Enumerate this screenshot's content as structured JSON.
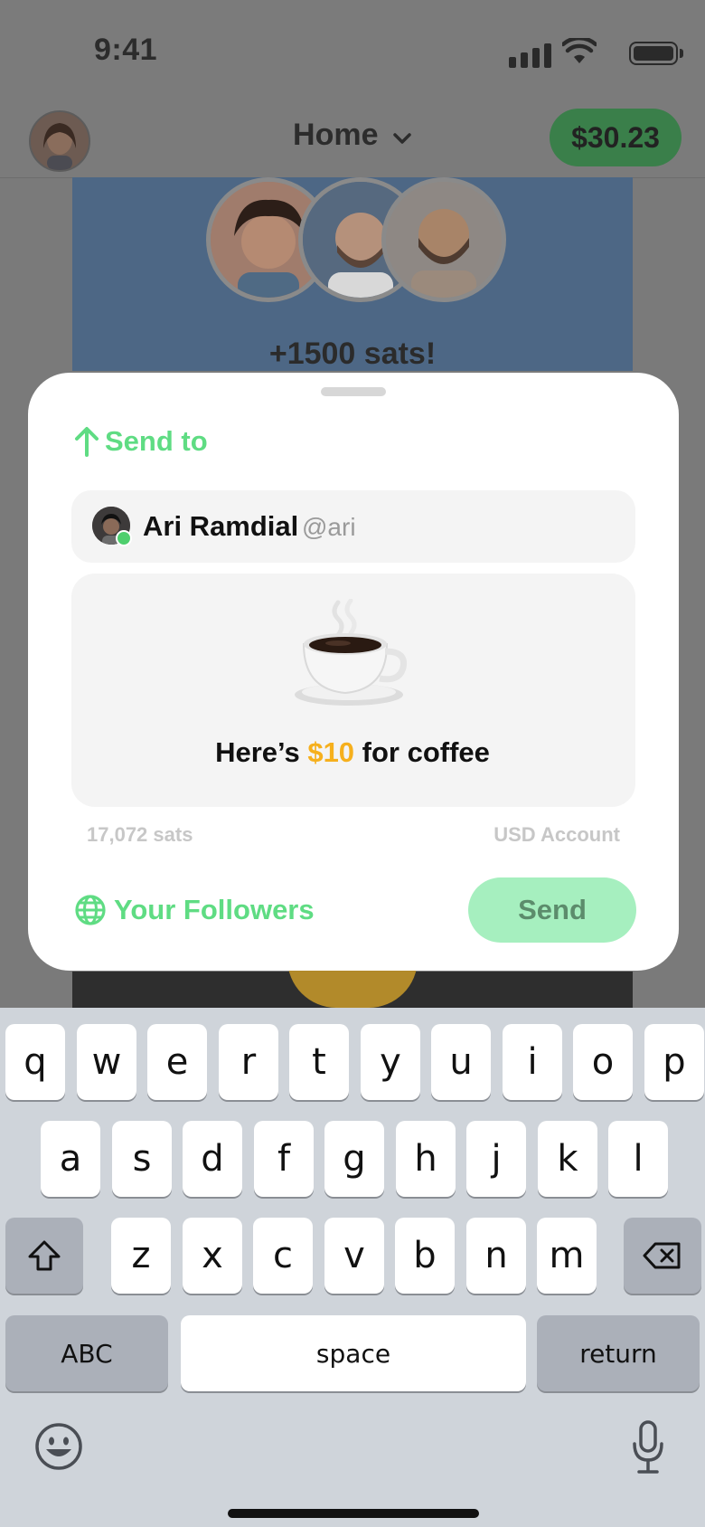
{
  "status_bar": {
    "time": "9:41"
  },
  "header": {
    "title": "Home",
    "balance": "$30.23"
  },
  "background_card": {
    "headline": "+1500 sats!"
  },
  "sheet": {
    "send_to_label": "Send to",
    "recipient": {
      "name": "Ari Ramdial",
      "handle": "@ari"
    },
    "message": {
      "prefix": "Here’s ",
      "amount": "$10",
      "suffix": " for coffee"
    },
    "sats_value": "17,072 sats",
    "account_label": "USD Account",
    "audience_label": "Your Followers",
    "send_label": "Send"
  },
  "keyboard": {
    "row1": [
      "q",
      "w",
      "e",
      "r",
      "t",
      "y",
      "u",
      "i",
      "o",
      "p"
    ],
    "row2": [
      "a",
      "s",
      "d",
      "f",
      "g",
      "h",
      "j",
      "k",
      "l"
    ],
    "row3": [
      "z",
      "x",
      "c",
      "v",
      "b",
      "n",
      "m"
    ],
    "abc_label": "ABC",
    "space_label": "space",
    "return_label": "return"
  },
  "icons": {
    "shift": "shift-icon",
    "delete": "delete-icon",
    "emoji": "emoji-icon",
    "mic": "mic-icon",
    "globe": "globe-icon",
    "arrow": "arrow-up-icon"
  },
  "colors": {
    "accent_green": "#5fdc83",
    "amount_gold": "#f6b01d",
    "send_button": "#a6efbf"
  }
}
